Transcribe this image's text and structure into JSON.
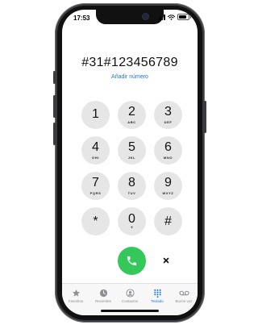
{
  "status": {
    "time": "17:53",
    "battery_level": 0.8
  },
  "dialer": {
    "number": "#31#123456789",
    "add_number": "Añadir número"
  },
  "keypad": [
    {
      "digit": "1",
      "letters": ""
    },
    {
      "digit": "2",
      "letters": "ABC"
    },
    {
      "digit": "3",
      "letters": "DEF"
    },
    {
      "digit": "4",
      "letters": "GHI"
    },
    {
      "digit": "5",
      "letters": "JKL"
    },
    {
      "digit": "6",
      "letters": "MNO"
    },
    {
      "digit": "7",
      "letters": "PQRS"
    },
    {
      "digit": "8",
      "letters": "TUV"
    },
    {
      "digit": "9",
      "letters": "WXYZ"
    },
    {
      "digit": "*",
      "letters": ""
    },
    {
      "digit": "0",
      "letters": "+"
    },
    {
      "digit": "#",
      "letters": ""
    }
  ],
  "actions": {
    "call_icon": "phone-icon",
    "delete_icon": "delete-icon"
  },
  "tabbar": {
    "tabs": [
      {
        "label": "Favoritos",
        "icon": "star-icon"
      },
      {
        "label": "Recientes",
        "icon": "clock-icon"
      },
      {
        "label": "Contactos",
        "icon": "person-icon"
      },
      {
        "label": "Teclado",
        "icon": "keypad-icon",
        "active": true
      },
      {
        "label": "Buzón voz",
        "icon": "voicemail-icon"
      }
    ]
  },
  "colors": {
    "accent": "#1a73e8",
    "call": "#34c759",
    "key": "#e6e6e7"
  }
}
